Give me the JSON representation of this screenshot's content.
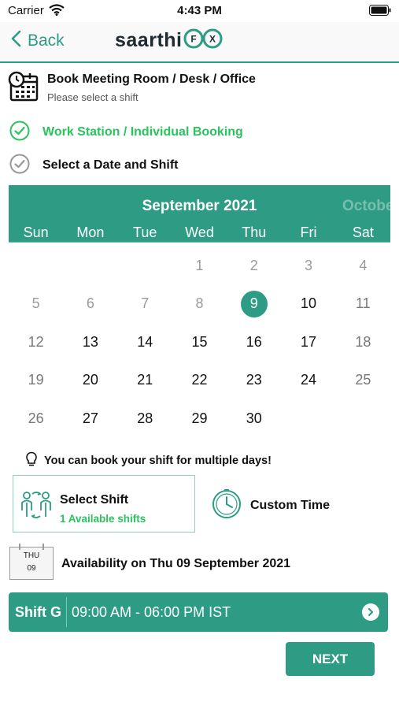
{
  "status_bar": {
    "carrier": "Carrier",
    "time": "4:43 PM"
  },
  "nav": {
    "back_label": "Back",
    "logo_text": "saarthi",
    "logo_fx_f": "F",
    "logo_fx_x": "X"
  },
  "header": {
    "title": "Book Meeting Room / Desk / Office",
    "subtitle": "Please select a shift"
  },
  "steps": [
    {
      "label": "Work Station / Individual Booking",
      "state": "done"
    },
    {
      "label": "Select a Date and Shift",
      "state": "current"
    }
  ],
  "calendar": {
    "month_label": "September 2021",
    "next_month_label": "October",
    "weekdays": [
      "Sun",
      "Mon",
      "Tue",
      "Wed",
      "Thu",
      "Fri",
      "Sat"
    ],
    "selected_day": "9",
    "weeks": [
      [
        {
          "d": ""
        },
        {
          "d": ""
        },
        {
          "d": ""
        },
        {
          "d": "1",
          "s": "disabled"
        },
        {
          "d": "2",
          "s": "disabled"
        },
        {
          "d": "3",
          "s": "disabled"
        },
        {
          "d": "4",
          "s": "disabled"
        }
      ],
      [
        {
          "d": "5",
          "s": "disabled"
        },
        {
          "d": "6",
          "s": "disabled"
        },
        {
          "d": "7",
          "s": "disabled"
        },
        {
          "d": "8",
          "s": "disabled"
        },
        {
          "d": "9",
          "s": "selected"
        },
        {
          "d": "10",
          "s": "active"
        },
        {
          "d": "11",
          "s": "weekend"
        }
      ],
      [
        {
          "d": "12",
          "s": "weekend"
        },
        {
          "d": "13",
          "s": "active"
        },
        {
          "d": "14",
          "s": "active"
        },
        {
          "d": "15",
          "s": "active"
        },
        {
          "d": "16",
          "s": "active"
        },
        {
          "d": "17",
          "s": "active"
        },
        {
          "d": "18",
          "s": "weekend"
        }
      ],
      [
        {
          "d": "19",
          "s": "weekend"
        },
        {
          "d": "20",
          "s": "active"
        },
        {
          "d": "21",
          "s": "active"
        },
        {
          "d": "22",
          "s": "active"
        },
        {
          "d": "23",
          "s": "active"
        },
        {
          "d": "24",
          "s": "active"
        },
        {
          "d": "25",
          "s": "weekend"
        }
      ],
      [
        {
          "d": "26",
          "s": "weekend"
        },
        {
          "d": "27",
          "s": "active"
        },
        {
          "d": "28",
          "s": "active"
        },
        {
          "d": "29",
          "s": "active"
        },
        {
          "d": "30",
          "s": "active"
        },
        {
          "d": ""
        },
        {
          "d": ""
        }
      ]
    ]
  },
  "hint": {
    "text": "You can book your shift for multiple days!",
    "icon": "lightbulb-icon"
  },
  "options": {
    "select_shift": {
      "title": "Select Shift",
      "subtitle": "1 Available shifts",
      "icon": "people-swap-icon"
    },
    "custom_time": {
      "title": "Custom Time",
      "icon": "clock-icon"
    }
  },
  "availability": {
    "badge_dow": "THU",
    "badge_day": "09",
    "text": "Availability on Thu 09 September 2021"
  },
  "shift": {
    "name": "Shift G",
    "time": "09:00 AM - 06:00 PM IST"
  },
  "actions": {
    "next_label": "NEXT"
  },
  "colors": {
    "primary": "#2e9c84",
    "success": "#29c45e",
    "weekend": "#777777",
    "disabled": "#9a9a9a"
  }
}
